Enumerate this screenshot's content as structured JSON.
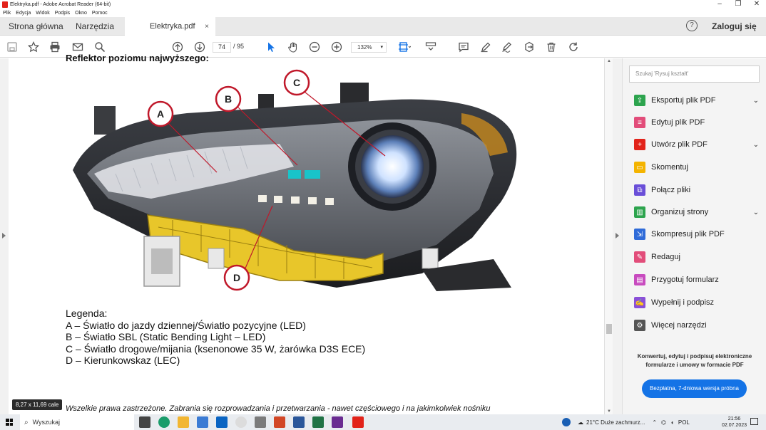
{
  "window": {
    "title": "Elektryka.pdf - Adobe Acrobat Reader (64-bit)",
    "controls": [
      "–",
      "❐",
      "✕"
    ]
  },
  "menu": [
    "Plik",
    "Edycja",
    "Widok",
    "Podpis",
    "Okno",
    "Pomoc"
  ],
  "tabs": {
    "home": "Strona główna",
    "tools": "Narzędzia",
    "document": "Elektryka.pdf",
    "close": "×",
    "login": "Zaloguj się",
    "help": "?"
  },
  "toolbar": {
    "page_current": "74",
    "page_total": "/ 95",
    "zoom": "132%"
  },
  "document": {
    "heading_partial": "Reflektor poziomu najwyższego:",
    "callouts": [
      "A",
      "B",
      "C",
      "D"
    ],
    "legend": {
      "title": "Legenda:",
      "a": "A – Światło do jazdy dziennej/Światło pozycyjne (LED)",
      "b": "B – Światło SBL (Static Bending Light – LED)",
      "c": "C – Światło drogowe/mijania (ksenonowe 35 W, żarówka D3S ECE)",
      "d": "D – Kierunkowskaz (LEC)"
    },
    "footer": "Wszelkie prawa zastrzeżone. Zabrania się rozprowadzania i przetwarzania - nawet częściowego i na jakimkolwiek nośniku",
    "page_size": "8,27 x 11,69 cale"
  },
  "right_panel": {
    "search_placeholder": "Szukaj 'Rysuj kształt'",
    "tools": [
      {
        "label": "Eksportuj plik PDF",
        "icon": "export-pdf-icon",
        "color": "#2da44e"
      },
      {
        "label": "Edytuj plik PDF",
        "icon": "edit-pdf-icon",
        "color": "#e24d7a"
      },
      {
        "label": "Utwórz plik PDF",
        "icon": "create-pdf-icon",
        "color": "#e2231a"
      },
      {
        "label": "Skomentuj",
        "icon": "comment-icon",
        "color": "#f4b400"
      },
      {
        "label": "Połącz pliki",
        "icon": "combine-files-icon",
        "color": "#6a4fd8"
      },
      {
        "label": "Organizuj strony",
        "icon": "organize-pages-icon",
        "color": "#2da44e"
      },
      {
        "label": "Skompresuj plik PDF",
        "icon": "compress-pdf-icon",
        "color": "#2f6bd8"
      },
      {
        "label": "Redaguj",
        "icon": "redact-icon",
        "color": "#e24d7a"
      },
      {
        "label": "Przygotuj formularz",
        "icon": "prepare-form-icon",
        "color": "#c84bbf"
      },
      {
        "label": "Wypełnij i podpisz",
        "icon": "fill-sign-icon",
        "color": "#8a4fd8"
      },
      {
        "label": "Więcej narzędzi",
        "icon": "more-tools-icon",
        "color": "#555555"
      }
    ],
    "promo_text": "Konwertuj, edytuj i podpisuj elektroniczne formularze i umowy w formacie PDF",
    "promo_button": "Bezpłatna, 7-dniowa wersja próbna"
  },
  "taskbar": {
    "search": "Wyszukaj",
    "weather": "21°C  Duże zachmurz...",
    "lang": "POL",
    "time": "21:56",
    "date": "02.07.2023"
  }
}
